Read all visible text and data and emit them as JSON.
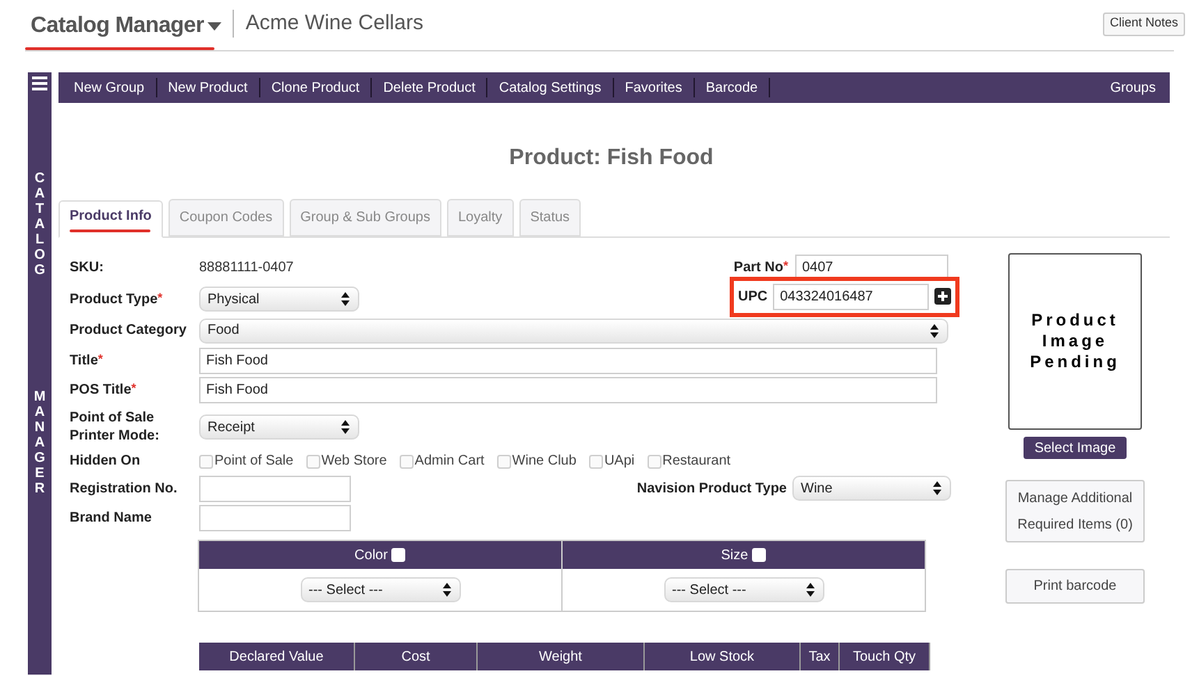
{
  "header": {
    "app_title": "Catalog Manager",
    "company": "Acme Wine Cellars",
    "client_notes": "Client Notes"
  },
  "sidebar": {
    "words": [
      "CATALOG",
      "MANAGER"
    ]
  },
  "toolbar": {
    "items": [
      "New Group",
      "New Product",
      "Clone Product",
      "Delete Product",
      "Catalog Settings",
      "Favorites",
      "Barcode"
    ],
    "right_item": "Groups"
  },
  "page_title": "Product: Fish Food",
  "tabs": [
    {
      "label": "Product Info",
      "selected": true
    },
    {
      "label": "Coupon Codes",
      "selected": false
    },
    {
      "label": "Group & Sub Groups",
      "selected": false
    },
    {
      "label": "Loyalty",
      "selected": false
    },
    {
      "label": "Status",
      "selected": false
    }
  ],
  "form": {
    "sku": {
      "label": "SKU:",
      "value": "88881111-0407"
    },
    "part_no": {
      "label": "Part No",
      "required_mark": "*",
      "value": "0407"
    },
    "product_type": {
      "label": "Product Type",
      "required_mark": "*",
      "value": "Physical"
    },
    "upc": {
      "label": "UPC",
      "value": "043324016487"
    },
    "product_category": {
      "label": "Product Category",
      "value": "Food"
    },
    "title": {
      "label": "Title",
      "required_mark": "*",
      "value": "Fish Food"
    },
    "pos_title": {
      "label": "POS Title",
      "required_mark": "*",
      "value": "Fish Food"
    },
    "printer_mode": {
      "label_lines": [
        "Point of Sale",
        "Printer Mode:"
      ],
      "value": "Receipt"
    },
    "hidden_on": {
      "label": "Hidden On",
      "options": [
        {
          "label": "Point of Sale",
          "checked": false
        },
        {
          "label": "Web Store",
          "checked": false
        },
        {
          "label": "Admin Cart",
          "checked": false
        },
        {
          "label": "Wine Club",
          "checked": false
        },
        {
          "label": "UApi",
          "checked": false
        },
        {
          "label": "Restaurant",
          "checked": false
        }
      ]
    },
    "registration_no": {
      "label": "Registration No."
    },
    "navision_type": {
      "label": "Navision Product Type",
      "value": "Wine"
    },
    "brand_name": {
      "label": "Brand Name"
    }
  },
  "variants": [
    {
      "label": "Color",
      "checked": false,
      "value": "--- Select ---"
    },
    {
      "label": "Size",
      "checked": false,
      "value": "--- Select ---"
    }
  ],
  "image_panel": {
    "placeholder_lines": [
      "Product",
      "Image",
      "Pending"
    ],
    "select_button": "Select Image",
    "manage_button_lines": [
      "Manage Additional",
      "Required Items (0)"
    ],
    "print_button": "Print barcode"
  },
  "pricing_table": {
    "columns": [
      "Declared Value",
      "Cost",
      "Weight",
      "Low Stock",
      "Tax",
      "Touch Qty"
    ]
  }
}
